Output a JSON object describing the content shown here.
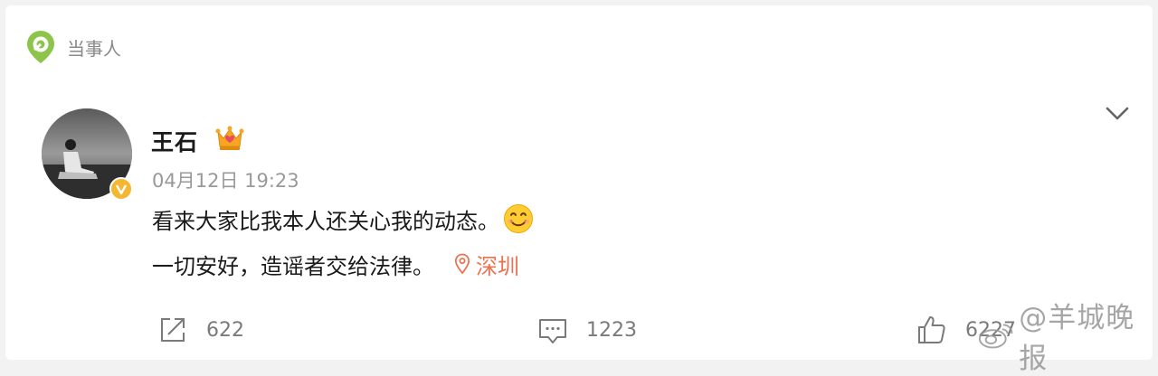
{
  "topic_tag": {
    "label": "当事人",
    "icon": "location-pin-icon",
    "color": "#8dc44a"
  },
  "post": {
    "username": "王石",
    "member_badge": "crown-icon",
    "verified_badge": "verified-icon",
    "timestamp": "04月12日 19:23",
    "text_line1": "看来大家比我本人还关心我的动态。",
    "emoji": "smile-emoji",
    "text_line2": "一切安好，造谣者交给法律。",
    "location": "深圳",
    "location_color": "#eb7350"
  },
  "actions": {
    "repost_count": "622",
    "comment_count": "1223",
    "like_count": "6227"
  },
  "watermark": {
    "text": "@羊城晚报"
  }
}
